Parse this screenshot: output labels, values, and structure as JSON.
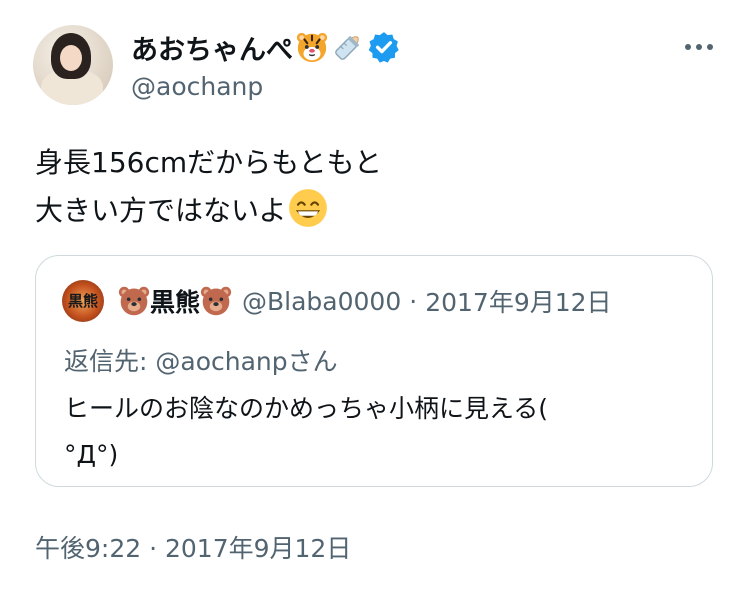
{
  "author": {
    "display_name": "あおちゃんぺ",
    "name_emojis": [
      "tiger-face-emoji",
      "baby-bottle-emoji"
    ],
    "verified": true,
    "handle": "@aochanp"
  },
  "tweet": {
    "lines": [
      "身長156cmだからもともと",
      "大きい方ではないよ"
    ],
    "trailing_emoji": "grinning-face-emoji"
  },
  "quoted_tweet": {
    "avatar_text": "黒熊",
    "name": "黒熊",
    "name_emoji": "bear-face-emoji",
    "handle": "@Blaba0000",
    "separator": "·",
    "date": "2017年9月12日",
    "reply_to": "返信先: @aochanpさん",
    "lines": [
      "ヒールのお陰なのかめっちゃ小柄に見える(",
      "°Д°)"
    ]
  },
  "timestamp": {
    "time": "午後9:22",
    "separator": "·",
    "date": "2017年9月12日"
  },
  "colors": {
    "text_primary": "#0f1419",
    "text_secondary": "#536471",
    "verified_blue": "#1d9bf0",
    "border": "#cfd9de"
  }
}
